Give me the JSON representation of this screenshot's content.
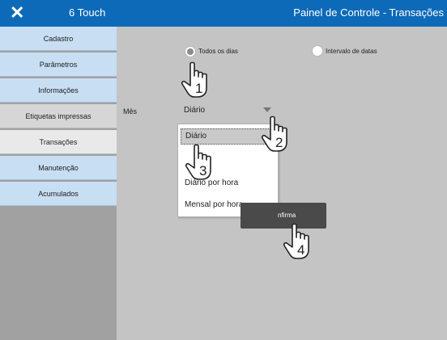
{
  "header": {
    "close_icon": "close-icon",
    "app_title": "6 Touch",
    "page_title": "Painel de Controle - Transações"
  },
  "sidebar": {
    "items": [
      {
        "label": "Cadastro"
      },
      {
        "label": "Parâmetros"
      },
      {
        "label": "Informações"
      },
      {
        "label": "Etiquetas impressas"
      },
      {
        "label": "Transações"
      },
      {
        "label": "Manutenção"
      },
      {
        "label": "Acumulados"
      }
    ]
  },
  "filters": {
    "radio_all_days": "Todos os dias",
    "radio_date_range": "Intervalo de datas",
    "selected_radio": "Todos os dias"
  },
  "period": {
    "label": "Mês",
    "selected": "Diário",
    "options": [
      "Diário",
      "Diário por hora",
      "Mensal por hora"
    ]
  },
  "confirm_button": {
    "label": "Confirma",
    "visible_part": "nfirma"
  },
  "step_markers": [
    "1",
    "2",
    "3",
    "4"
  ],
  "colors": {
    "header_bg": "#0d6ab8",
    "sidebar_blue": "#c8def3",
    "main_bg": "#c4c4c4",
    "button_bg": "#4a4a4a"
  }
}
